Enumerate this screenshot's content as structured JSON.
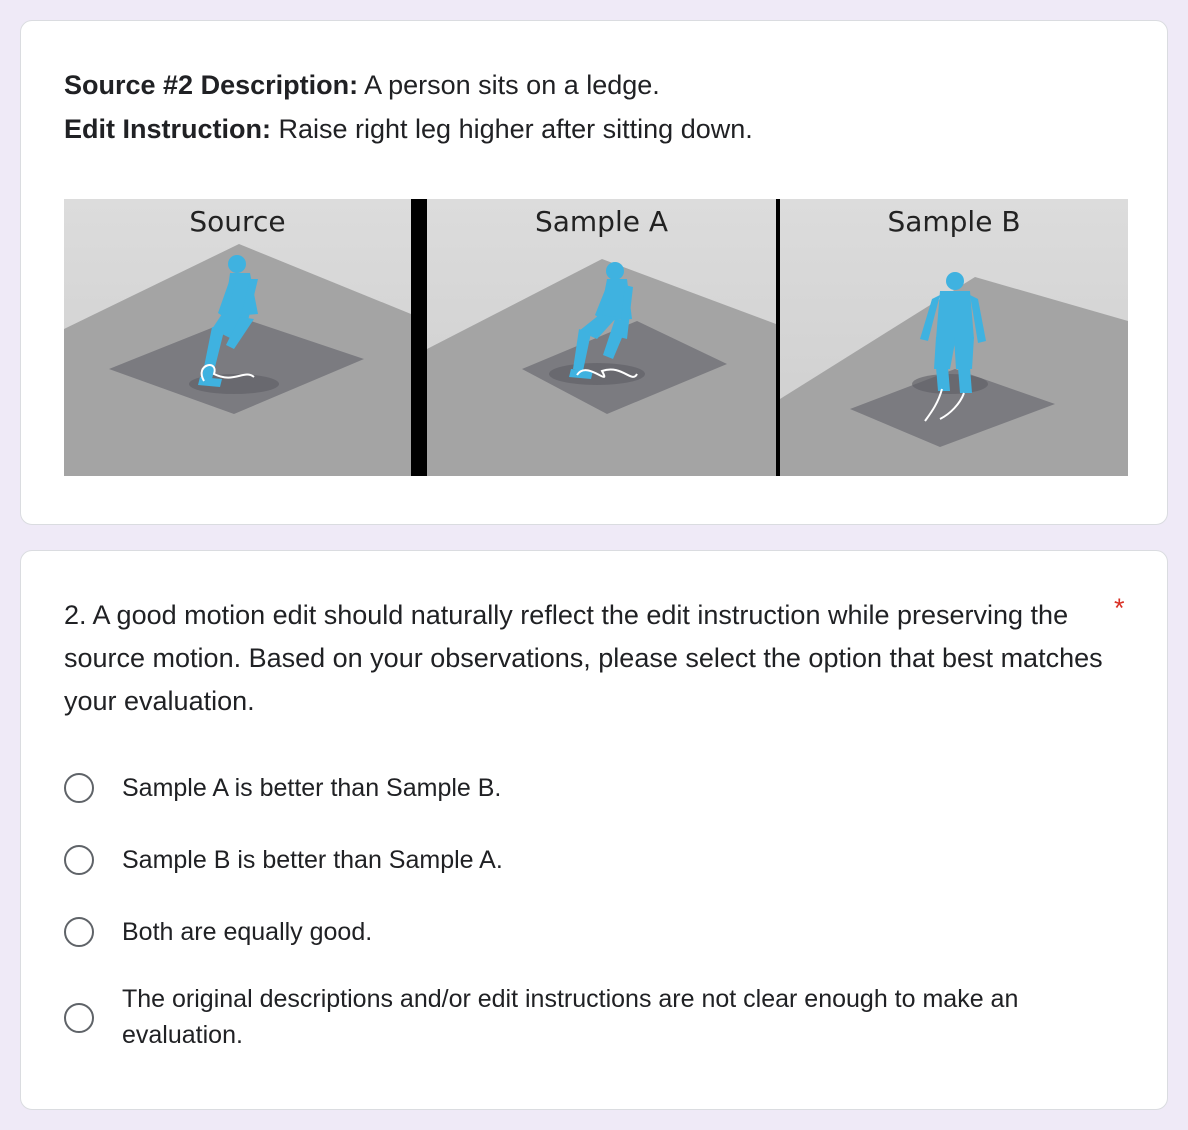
{
  "card1": {
    "source_label": "Source #2 Description:",
    "source_text": " A person sits on a ledge.",
    "edit_label": "Edit Instruction:",
    "edit_text": " Raise right leg higher after sitting down."
  },
  "panels": {
    "source": "Source",
    "sample_a": "Sample A",
    "sample_b": "Sample B"
  },
  "card2": {
    "question": "2. A good motion edit should naturally reflect the edit instruction while preserving the source motion. Based on your observations, please select the option that best matches your evaluation.",
    "required_mark": "*",
    "options": [
      "Sample A is better than Sample B.",
      "Sample B is better than Sample A.",
      "Both are equally good.",
      "The original descriptions and/or edit instructions are not clear enough to make an evaluation."
    ]
  },
  "colors": {
    "page_bg": "#efeaf7",
    "figure": "#3fb2e0",
    "required": "#d93025"
  }
}
